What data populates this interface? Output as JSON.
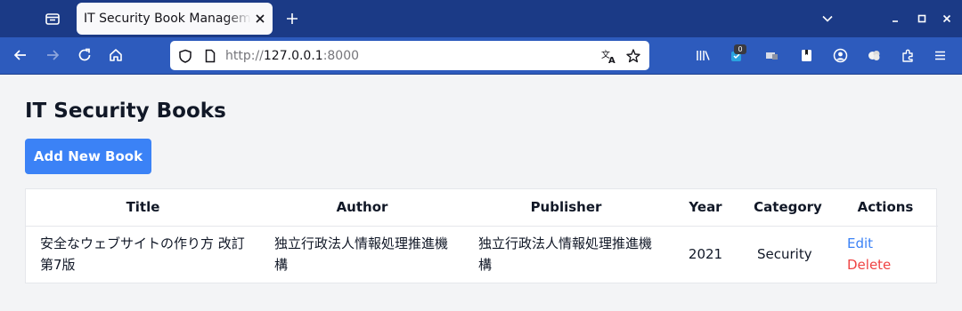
{
  "browser": {
    "tab_title": "IT Security Book Management",
    "url_prefix": "http://",
    "url_host": "127.0.0.1",
    "url_suffix": ":8000",
    "extension_badge": "0"
  },
  "page": {
    "title": "IT Security Books",
    "add_button": "Add New Book"
  },
  "table": {
    "headers": [
      "Title",
      "Author",
      "Publisher",
      "Year",
      "Category",
      "Actions"
    ],
    "rows": [
      {
        "title": "安全なウェブサイトの作り方 改訂第7版",
        "author": "独立行政法人情報処理推進機構",
        "publisher": "独立行政法人情報処理推進機構",
        "year": "2021",
        "category": "Security",
        "edit": "Edit",
        "delete": "Delete"
      }
    ]
  },
  "colors": {
    "tabbar": "#1b3a86",
    "navbar": "#2d5bbd",
    "accent": "#3b82f6",
    "danger": "#ef4444"
  },
  "icons": [
    "tab-list-icon",
    "close-icon",
    "plus-icon",
    "chevron-down-icon",
    "minimize-icon",
    "maximize-icon",
    "window-close-icon",
    "back-arrow-icon",
    "forward-arrow-icon",
    "reload-icon",
    "home-icon",
    "shield-icon",
    "page-icon",
    "translate-icon",
    "star-icon",
    "library-icon",
    "extension-badge-icon",
    "container-icon",
    "bookmark-icon",
    "account-icon",
    "puzzle-extension-icon",
    "extensions-icon",
    "menu-icon"
  ]
}
